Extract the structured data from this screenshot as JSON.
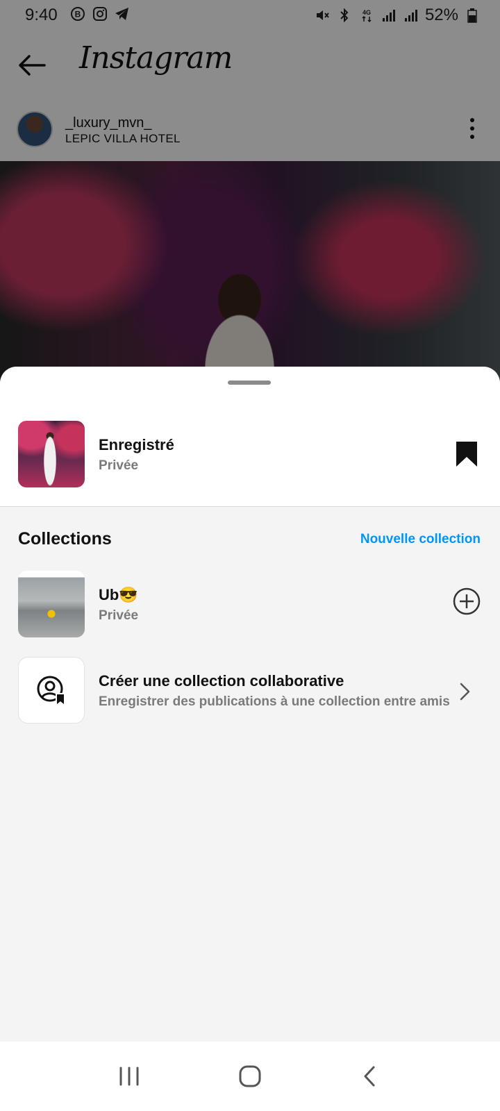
{
  "status_bar": {
    "time": "9:40",
    "battery": "52%",
    "left_icons": [
      "b-circle-icon",
      "instagram-icon",
      "telegram-icon"
    ],
    "right_icons": [
      "mute-icon",
      "bluetooth-icon",
      "4g-icon",
      "signal-icon",
      "signal-icon",
      "battery-icon"
    ]
  },
  "header": {
    "app_title": "Instagram"
  },
  "post": {
    "username": "_luxury_mvn_",
    "location": "LEPIC VILLA HOTEL"
  },
  "sheet": {
    "saved": {
      "title": "Enregistré",
      "privacy": "Privée"
    },
    "collections_heading": "Collections",
    "new_collection_label": "Nouvelle collection",
    "collections": [
      {
        "title": "Ub😎",
        "privacy": "Privée"
      }
    ],
    "collab": {
      "title": "Créer une collection collaborative",
      "subtitle": "Enregistrer des publications à une collection entre amis"
    }
  },
  "colors": {
    "accent": "#0095f6",
    "muted_text": "#7a7a7a",
    "sheet_bg": "#f4f4f4"
  }
}
